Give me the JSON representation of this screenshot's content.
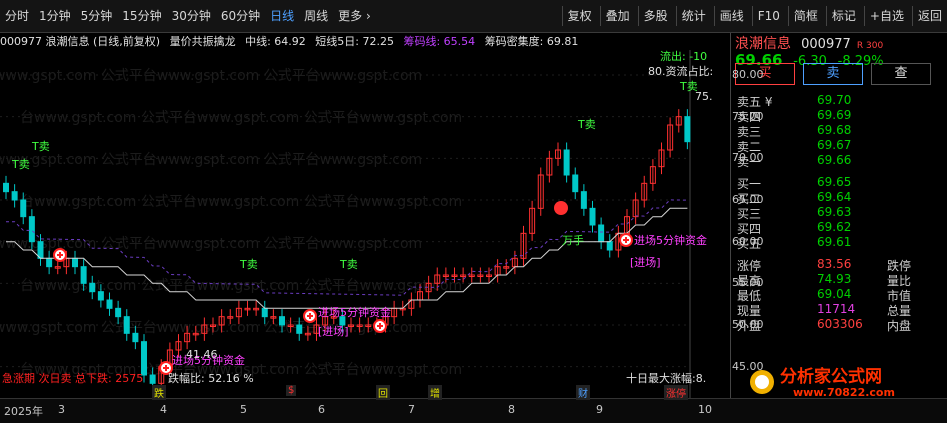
{
  "toolbar": {
    "periods": [
      "分时",
      "1分钟",
      "5分钟",
      "15分钟",
      "30分钟",
      "60分钟",
      "日线",
      "周线",
      "更多 ›"
    ],
    "active": "日线",
    "right": [
      "复权",
      "叠加",
      "多股",
      "统计",
      "画线",
      "F10",
      "简框",
      "标记",
      "+自选",
      "返回"
    ]
  },
  "info": {
    "stock": "000977 浪潮信息 (日线,前复权)",
    "indicator": "量价共振擒龙",
    "mid": "中线: 64.92",
    "short5": "短线5日: 72.25",
    "chip": "筹码线: 65.54",
    "chipdensity": "筹码密集度: 69.81"
  },
  "chart_data": {
    "type": "line",
    "x": [
      "2025年",
      "3",
      "4",
      "5",
      "6",
      "7",
      "8",
      "9",
      "10"
    ],
    "yticks": [
      45.0,
      50.0,
      55.0,
      60.0,
      65.0,
      70.0,
      75.0,
      80.0
    ],
    "ylim": [
      41,
      83
    ],
    "close": [
      66,
      65,
      63,
      60,
      58,
      57,
      57,
      58,
      57,
      55,
      54,
      53,
      52,
      51,
      49,
      48,
      44,
      43,
      45,
      47,
      48,
      49,
      49,
      50,
      50,
      51,
      51,
      52,
      52,
      52,
      51,
      51,
      50,
      50,
      49,
      49,
      50,
      51,
      51,
      50,
      50,
      50,
      50,
      50,
      51,
      52,
      52,
      53,
      54,
      55,
      56,
      56,
      56,
      56,
      56,
      56,
      56,
      57,
      57,
      58,
      61,
      64,
      68,
      70,
      71,
      68,
      66,
      64,
      62,
      60,
      59,
      61,
      63,
      65,
      67,
      69,
      71,
      74,
      75,
      72
    ],
    "ma": [
      60,
      60,
      59,
      59,
      58,
      58,
      58,
      58,
      58,
      58,
      57,
      57,
      57,
      57,
      56,
      56,
      56,
      55,
      55,
      54,
      54,
      54,
      53,
      53,
      53,
      53,
      53,
      53,
      53,
      53,
      52,
      52,
      52,
      52,
      52,
      52,
      52,
      52,
      52,
      52,
      52,
      52,
      52,
      52,
      52,
      52,
      52,
      53,
      53,
      53,
      53,
      54,
      54,
      54,
      55,
      55,
      55,
      56,
      56,
      57,
      57,
      58,
      58,
      59,
      59,
      60,
      60,
      60,
      60,
      60,
      60,
      61,
      61,
      62,
      62,
      63,
      63,
      64,
      64,
      64
    ]
  },
  "annotations": {
    "sells": [
      "T卖",
      "T卖",
      "T卖",
      "T卖",
      "T卖",
      "T卖"
    ],
    "entry": "[进场]",
    "entry5": "进场5分钟资金",
    "wan": "万手",
    "low_label": "41.46",
    "high_label": "75.",
    "outflow": "流出: -10",
    "ratio": "80.资流占比:",
    "bottom_left": "急涨期 次日卖 总下跌: 2575",
    "bottom_left2": "跌幅比: 52.16 %",
    "bottom_right": "十日最大涨幅:8.",
    "markers": [
      "跌",
      "$",
      "回",
      "增",
      "财",
      "涨停"
    ]
  },
  "side": {
    "name": "浪潮信息",
    "code": "000977",
    "badge": "R 300",
    "price": "69.66",
    "change": "-6.30",
    "pct": "-8.29%",
    "buy": "买",
    "sell": "卖",
    "query": "查",
    "asks": [
      [
        "卖五 ¥",
        "69.70"
      ],
      [
        "卖四",
        "69.69"
      ],
      [
        "卖三",
        "69.68"
      ],
      [
        "卖二",
        "69.67"
      ],
      [
        "卖一",
        "69.66"
      ]
    ],
    "bids": [
      [
        "买一",
        "69.65"
      ],
      [
        "买二",
        "69.64"
      ],
      [
        "买三",
        "69.63"
      ],
      [
        "买四",
        "69.62"
      ],
      [
        "买五",
        "69.61"
      ]
    ],
    "stats": [
      [
        "涨停",
        "83.56",
        "跌停"
      ],
      [
        "最高",
        "74.93",
        "量比"
      ],
      [
        "最低",
        "69.04",
        "市值"
      ],
      [
        "现量",
        "11714",
        "总量"
      ],
      [
        "外盘",
        "603306",
        "内盘"
      ]
    ]
  },
  "watermark": {
    "cn": "分析家公式网",
    "url": "www.70822.com"
  },
  "bg_watermark": "台www.gspt.com 公式平台www.gspt.com 公式平台www.gspt.com"
}
